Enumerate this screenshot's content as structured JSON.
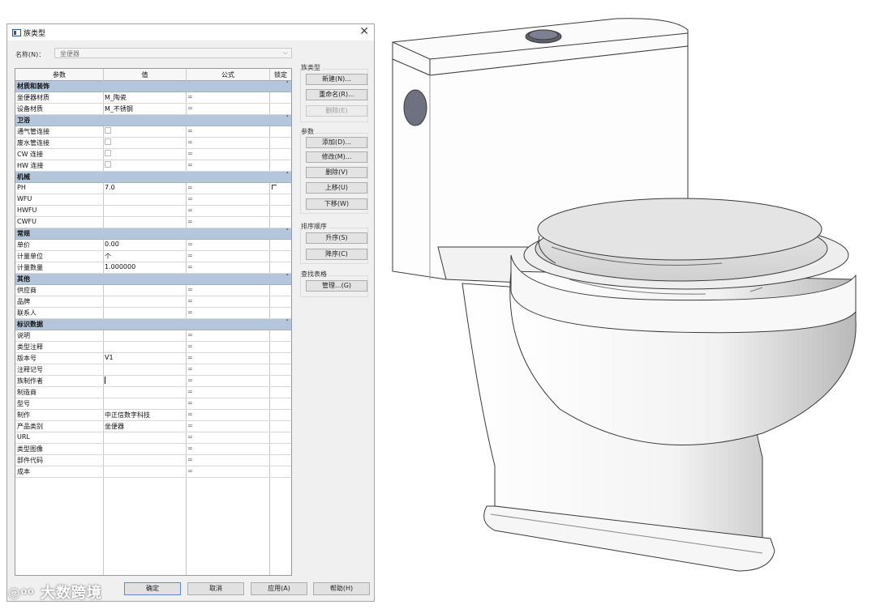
{
  "dialog": {
    "title": "族类型",
    "name_label": "名称(N)：",
    "name_value": "坐便器",
    "columns": [
      "参数",
      "值",
      "公式",
      "锁定"
    ],
    "rows": [
      {
        "type": "group",
        "label": "材质和装饰"
      },
      {
        "label": "坐便器材质",
        "value": "M_陶瓷",
        "formula": "="
      },
      {
        "label": "设备材质",
        "value": "M_不锈钢",
        "formula": "="
      },
      {
        "type": "group",
        "label": "卫浴"
      },
      {
        "label": "通气管连接",
        "check": true,
        "formula": "="
      },
      {
        "label": "废水管连接",
        "check": true,
        "formula": "="
      },
      {
        "label": "CW 连接",
        "check": true,
        "formula": "="
      },
      {
        "label": "HW 连接",
        "check": true,
        "formula": "="
      },
      {
        "type": "group",
        "label": "机械"
      },
      {
        "label": "PH",
        "value": "7.0",
        "formula": "=",
        "lock": true
      },
      {
        "label": "WFU",
        "value": "",
        "formula": "="
      },
      {
        "label": "HWFU",
        "value": "",
        "formula": "="
      },
      {
        "label": "CWFU",
        "value": "",
        "formula": "="
      },
      {
        "type": "group",
        "label": "常规"
      },
      {
        "label": "单价",
        "value": "0.00",
        "formula": "="
      },
      {
        "label": "计量单位",
        "value": "个",
        "formula": "="
      },
      {
        "label": "计量数量",
        "value": "1.000000",
        "formula": "="
      },
      {
        "type": "group",
        "label": "其他"
      },
      {
        "label": "供应商",
        "value": "",
        "formula": "="
      },
      {
        "label": "品牌",
        "value": "",
        "formula": "="
      },
      {
        "label": "联系人",
        "value": "",
        "formula": "="
      },
      {
        "type": "group",
        "label": "标识数据"
      },
      {
        "label": "说明",
        "value": "",
        "formula": "="
      },
      {
        "label": "类型注释",
        "value": "",
        "formula": "="
      },
      {
        "label": "版本号",
        "value": "V1",
        "formula": "="
      },
      {
        "label": "注释记号",
        "value": "",
        "formula": "="
      },
      {
        "label": "族制作者",
        "value": "",
        "cursor": true,
        "formula": "="
      },
      {
        "label": "制造商",
        "value": "",
        "formula": "="
      },
      {
        "label": "型号",
        "value": "",
        "formula": "="
      },
      {
        "label": "制作",
        "value": "中正信数字科技",
        "formula": "="
      },
      {
        "label": "产品类别",
        "value": "坐便器",
        "formula": "="
      },
      {
        "label": "URL",
        "value": "",
        "formula": "="
      },
      {
        "label": "类型图像",
        "value": "",
        "formula": "="
      },
      {
        "label": "部件代码",
        "value": "",
        "formula": "="
      },
      {
        "label": "成本",
        "value": "",
        "formula": "="
      }
    ],
    "side": {
      "family_types_label": "族类型",
      "new_btn": "新建(N)...",
      "rename_btn": "重命名(R)...",
      "delete_type_btn": "删除(E)",
      "params_label": "参数",
      "add_btn": "添加(D)...",
      "modify_btn": "修改(M)...",
      "remove_btn": "删除(V)",
      "move_up_btn": "上移(U)",
      "move_down_btn": "下移(W)",
      "sort_label": "排序顺序",
      "asc_btn": "升序(S)",
      "desc_btn": "降序(C)",
      "lookup_label": "查找表格",
      "manage_btn": "管理...(G)"
    },
    "buttons": {
      "ok": "确定",
      "cancel": "取消",
      "apply": "应用(A)",
      "help": "帮助(H)"
    }
  },
  "watermark": "大数跨境",
  "icons": [
    "family-icon",
    "close-icon",
    "chevron-down-icon",
    "collapse-caret-icon",
    "checkbox-icon",
    "lock-checkbox-icon"
  ],
  "colors": {
    "group_header": "#b4c6dc",
    "dialog_bg": "#f0f0f0"
  }
}
